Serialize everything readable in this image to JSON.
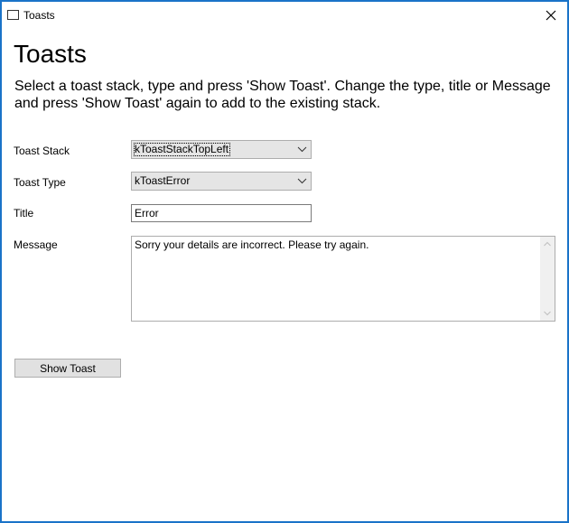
{
  "window": {
    "title": "Toasts",
    "icon": "window-icon",
    "close_icon": "close-icon"
  },
  "page": {
    "heading": "Toasts",
    "instructions": "Select a toast stack, type and press 'Show Toast'. Change the type, title or Message and press 'Show Toast' again to add to the existing stack."
  },
  "form": {
    "toast_stack": {
      "label": "Toast Stack",
      "value": "kToastStackTopLeft"
    },
    "toast_type": {
      "label": "Toast Type",
      "value": "kToastError"
    },
    "title": {
      "label": "Title",
      "value": "Error"
    },
    "message": {
      "label": "Message",
      "value": "Sorry your details are incorrect. Please try again."
    },
    "show_toast_label": "Show Toast"
  },
  "colors": {
    "window_border": "#1a73c8",
    "combo_background": "#e5e5e5",
    "button_background": "#e1e1e1"
  }
}
